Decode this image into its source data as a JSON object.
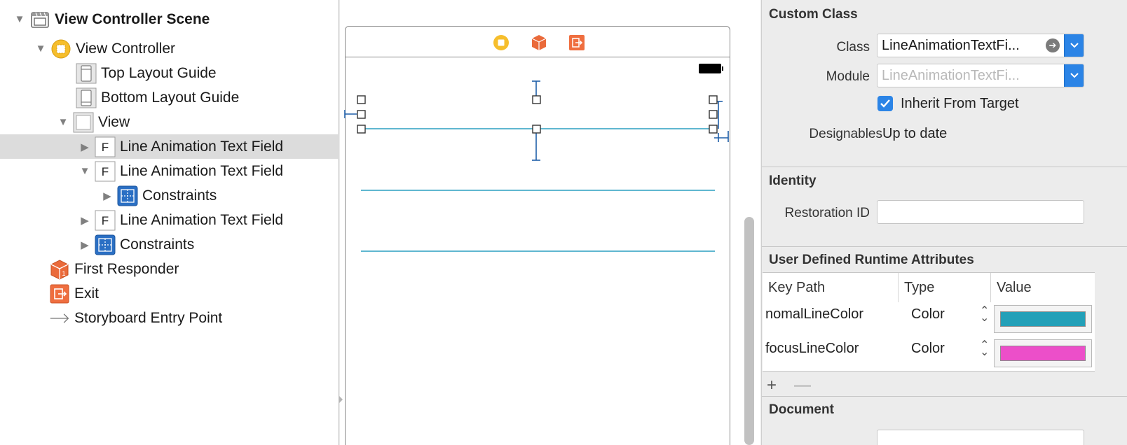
{
  "outline": {
    "items": [
      {
        "label": "View Controller Scene",
        "icon": "scene-icon",
        "disclosure": "expanded"
      },
      {
        "label": "View Controller",
        "icon": "view-controller-icon",
        "disclosure": "expanded"
      },
      {
        "label": "Top Layout Guide",
        "icon": "layout-guide-icon",
        "disclosure": "none"
      },
      {
        "label": "Bottom Layout Guide",
        "icon": "layout-guide-icon",
        "disclosure": "none"
      },
      {
        "label": "View",
        "icon": "view-icon",
        "disclosure": "expanded"
      },
      {
        "label": "Line Animation Text Field",
        "icon": "text-field-icon",
        "disclosure": "collapsed",
        "selected": true
      },
      {
        "label": "Line Animation Text Field",
        "icon": "text-field-icon",
        "disclosure": "expanded"
      },
      {
        "label": "Constraints",
        "icon": "constraints-icon",
        "disclosure": "collapsed"
      },
      {
        "label": "Line Animation Text Field",
        "icon": "text-field-icon",
        "disclosure": "collapsed"
      },
      {
        "label": "Constraints",
        "icon": "constraints-icon",
        "disclosure": "collapsed"
      },
      {
        "label": "First Responder",
        "icon": "first-responder-icon",
        "disclosure": "none"
      },
      {
        "label": "Exit",
        "icon": "exit-icon",
        "disclosure": "none"
      },
      {
        "label": "Storyboard Entry Point",
        "icon": "arrow-icon",
        "disclosure": "none"
      }
    ]
  },
  "canvas": {
    "scene_icons": [
      "view-controller-icon",
      "first-responder-icon",
      "exit-icon"
    ],
    "line_color": "#2a9fc0",
    "constraint_color": "#1f5fa8"
  },
  "inspector": {
    "custom_class": {
      "title": "Custom Class",
      "class_label": "Class",
      "class_value": "LineAnimationTextFi...",
      "module_label": "Module",
      "module_placeholder": "LineAnimationTextFi...",
      "inherit_label": "Inherit From Target",
      "inherit_checked": true,
      "designables_label": "Designables",
      "designables_value": "Up to date"
    },
    "identity": {
      "title": "Identity",
      "restoration_label": "Restoration ID",
      "restoration_value": ""
    },
    "runtime": {
      "title": "User Defined Runtime Attributes",
      "columns": [
        "Key Path",
        "Type",
        "Value"
      ],
      "rows": [
        {
          "key": "nomalLineColor",
          "type": "Color",
          "color": "#23a0b8"
        },
        {
          "key": "focusLineColor",
          "type": "Color",
          "color": "#ec4fc9"
        }
      ],
      "add": "+",
      "remove": "—"
    },
    "document": {
      "title": "Document"
    }
  },
  "colors": {
    "accent": "#2b84e6",
    "selection": "#dcdcdc"
  }
}
